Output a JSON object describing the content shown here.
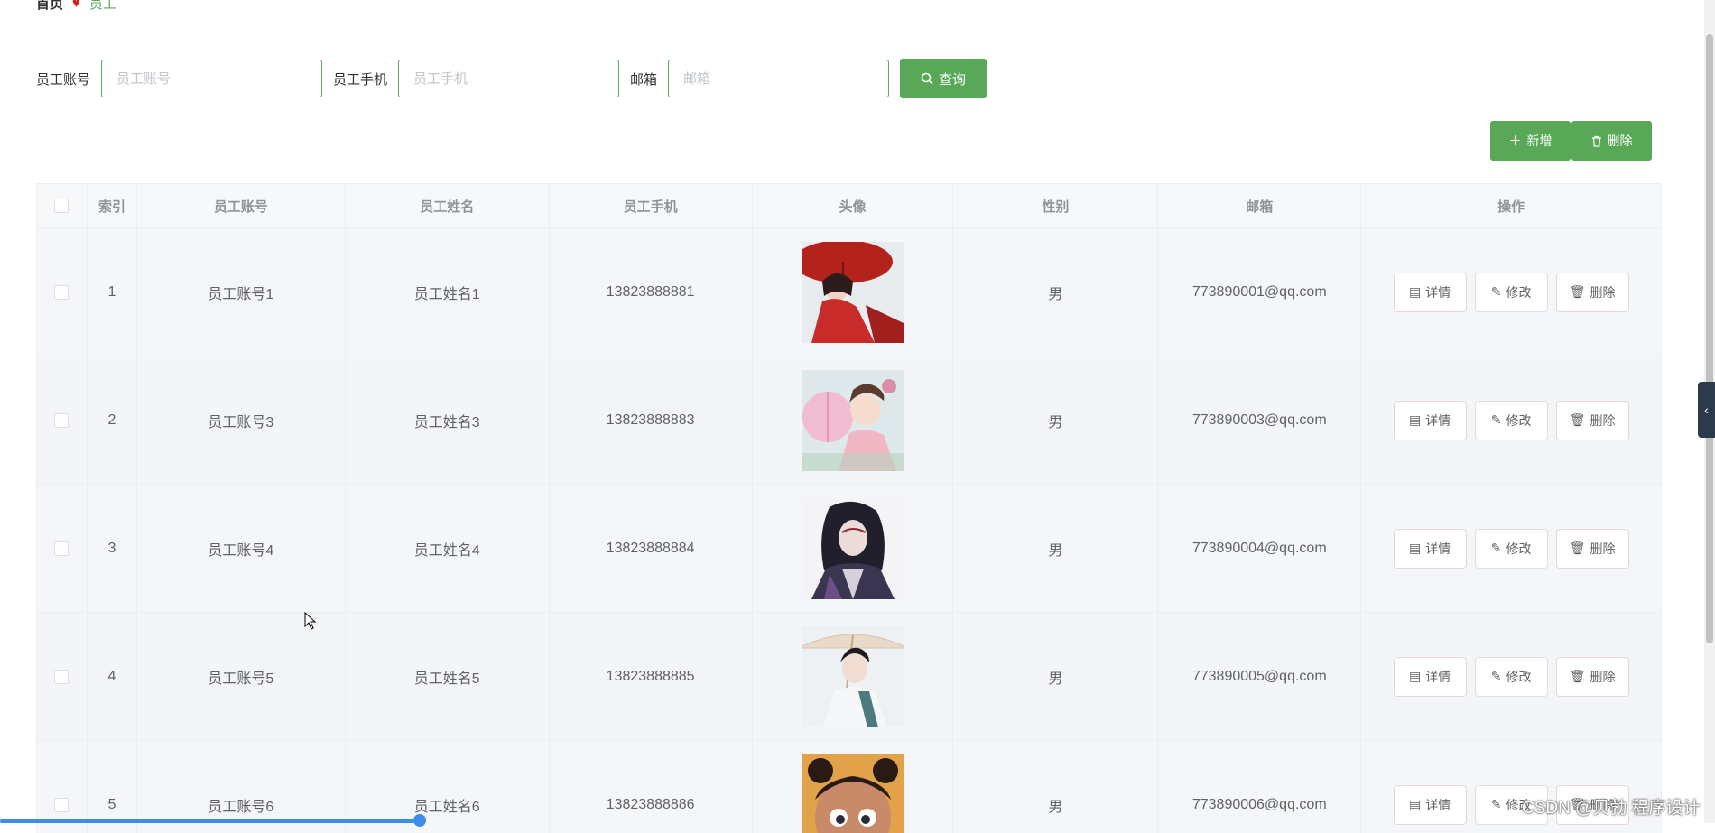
{
  "breadcrumb": {
    "home": "首页",
    "current": "员工"
  },
  "search": {
    "account_label": "员工账号",
    "account_placeholder": "员工账号",
    "phone_label": "员工手机",
    "phone_placeholder": "员工手机",
    "email_label": "邮箱",
    "email_placeholder": "邮箱",
    "query_label": "查询"
  },
  "actions": {
    "add_label": "新增",
    "delete_label": "删除"
  },
  "table": {
    "headers": {
      "index": "索引",
      "account": "员工账号",
      "name": "员工姓名",
      "phone": "员工手机",
      "avatar": "头像",
      "gender": "性别",
      "email": "邮箱",
      "ops": "操作"
    },
    "op_labels": {
      "detail": "详情",
      "edit": "修改",
      "delete": "删除"
    },
    "rows": [
      {
        "index": "1",
        "account": "员工账号1",
        "name": "员工姓名1",
        "phone": "13823888881",
        "gender": "男",
        "email": "773890001@qq.com"
      },
      {
        "index": "2",
        "account": "员工账号3",
        "name": "员工姓名3",
        "phone": "13823888883",
        "gender": "男",
        "email": "773890003@qq.com"
      },
      {
        "index": "3",
        "account": "员工账号4",
        "name": "员工姓名4",
        "phone": "13823888884",
        "gender": "男",
        "email": "773890004@qq.com"
      },
      {
        "index": "4",
        "account": "员工账号5",
        "name": "员工姓名5",
        "phone": "13823888885",
        "gender": "男",
        "email": "773890005@qq.com"
      },
      {
        "index": "5",
        "account": "员工账号6",
        "name": "员工姓名6",
        "phone": "13823888886",
        "gender": "男",
        "email": "773890006@qq.com"
      }
    ]
  },
  "watermark": "CSDN @贝勃 程序设计",
  "colors": {
    "accent": "#58a858",
    "heart": "#e0191d",
    "scroll": "#3c8ee8"
  }
}
